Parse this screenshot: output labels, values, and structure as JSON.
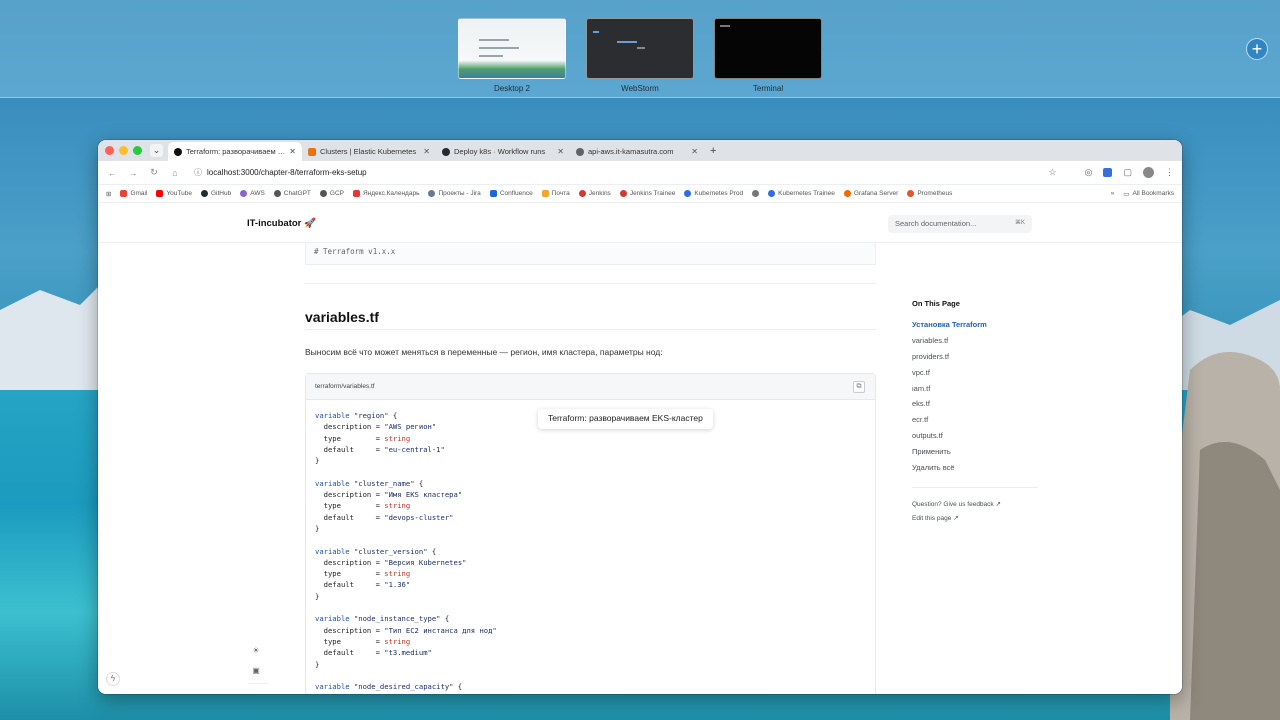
{
  "spaces": [
    {
      "label": "Desktop 2"
    },
    {
      "label": "WebStorm"
    },
    {
      "label": "Terminal"
    }
  ],
  "add_space_label": "+",
  "browser": {
    "tabs": [
      {
        "title": "Terraform: разворачиваем EKS",
        "color": "#111111",
        "active": true
      },
      {
        "title": "Clusters | Elastic Kubernetes",
        "color": "#ec7211",
        "active": false
      },
      {
        "title": "Deploy k8s · Workflow runs",
        "color": "#24292f",
        "active": false
      },
      {
        "title": "api-aws.it-kamasutra.com",
        "color": "#5f6368",
        "active": false
      }
    ],
    "url": "localhost:3000/chapter-8/terraform-eks-setup",
    "bookmarks": [
      {
        "label": "Gmail",
        "color": "#ea4335"
      },
      {
        "label": "YouTube",
        "color": "#ff0000"
      },
      {
        "label": "GitHub",
        "color": "#24292f"
      },
      {
        "label": "AWS",
        "color": "#8a63d2"
      },
      {
        "label": "ChatGPT",
        "color": "#555555"
      },
      {
        "label": "GCP",
        "color": "#555555"
      },
      {
        "label": "Яндекс.Календарь",
        "color": "#e53935"
      },
      {
        "label": "Проекты - Jira",
        "color": "#6b778c"
      },
      {
        "label": "Confluence",
        "color": "#1868db"
      },
      {
        "label": "Почта",
        "color": "#f4a62a"
      },
      {
        "label": "Jenkins",
        "color": "#d33833"
      },
      {
        "label": "Jenkins Trainee",
        "color": "#d33833"
      },
      {
        "label": "Kubernetes Prod",
        "color": "#326ce5"
      },
      {
        "label": "",
        "color": "#777777"
      },
      {
        "label": "Kubernetes Trainee",
        "color": "#326ce5"
      },
      {
        "label": "Grafana Server",
        "color": "#f46800"
      },
      {
        "label": "Prometheus",
        "color": "#e6522c"
      }
    ],
    "more_bookmarks": "»",
    "all_bookmarks": "All Bookmarks"
  },
  "site": {
    "logo": "IT-incubator 🚀",
    "search_placeholder": "Search documentation...",
    "search_shortcut": "⌘K"
  },
  "content": {
    "prev_code_comment": "# Terraform v1.x.x",
    "heading": "variables.tf",
    "paragraph": "Выносим всё что может меняться в переменные — регион, имя кластера, параметры нод:",
    "code_file": "terraform/variables.tf",
    "tooltip": "Terraform: разворачиваем EKS-кластер"
  },
  "toc": {
    "title": "On This Page",
    "items": [
      {
        "label": "Установка Terraform",
        "active": true
      },
      {
        "label": "variables.tf",
        "active": false
      },
      {
        "label": "providers.tf",
        "active": false
      },
      {
        "label": "vpc.tf",
        "active": false
      },
      {
        "label": "iam.tf",
        "active": false
      },
      {
        "label": "eks.tf",
        "active": false
      },
      {
        "label": "ecr.tf",
        "active": false
      },
      {
        "label": "outputs.tf",
        "active": false
      },
      {
        "label": "Применить",
        "active": false
      },
      {
        "label": "Удалить всё",
        "active": false
      }
    ],
    "feedback": "Question? Give us feedback ↗",
    "edit": "Edit this page ↗"
  },
  "code_lines": [
    [
      [
        "kw",
        "variable "
      ],
      [
        "str",
        "\"region\""
      ],
      [
        "",
        "{"
      ]
    ],
    [
      [
        "",
        "  description = "
      ],
      [
        "str",
        "\"AWS регион\""
      ]
    ],
    [
      [
        "",
        "  type        = "
      ],
      [
        "ty",
        "string"
      ]
    ],
    [
      [
        "",
        "  default     = "
      ],
      [
        "str",
        "\"eu-central-1\""
      ]
    ],
    [
      [
        "",
        "}"
      ]
    ],
    [
      [
        "",
        ""
      ]
    ],
    [
      [
        "kw",
        "variable "
      ],
      [
        "str",
        "\"cluster_name\""
      ],
      [
        "",
        "{"
      ]
    ],
    [
      [
        "",
        "  description = "
      ],
      [
        "str",
        "\"Имя EKS кластера\""
      ]
    ],
    [
      [
        "",
        "  type        = "
      ],
      [
        "ty",
        "string"
      ]
    ],
    [
      [
        "",
        "  default     = "
      ],
      [
        "str",
        "\"devops-cluster\""
      ]
    ],
    [
      [
        "",
        "}"
      ]
    ],
    [
      [
        "",
        ""
      ]
    ],
    [
      [
        "kw",
        "variable "
      ],
      [
        "str",
        "\"cluster_version\""
      ],
      [
        "",
        "{"
      ]
    ],
    [
      [
        "",
        "  description = "
      ],
      [
        "str",
        "\"Версия Kubernetes\""
      ]
    ],
    [
      [
        "",
        "  type        = "
      ],
      [
        "ty",
        "string"
      ]
    ],
    [
      [
        "",
        "  default     = "
      ],
      [
        "str",
        "\"1.36\""
      ]
    ],
    [
      [
        "",
        "}"
      ]
    ],
    [
      [
        "",
        ""
      ]
    ],
    [
      [
        "kw",
        "variable "
      ],
      [
        "str",
        "\"node_instance_type\""
      ],
      [
        "",
        "{"
      ]
    ],
    [
      [
        "",
        "  description = "
      ],
      [
        "str",
        "\"Тип EC2 инстанса для нод\""
      ]
    ],
    [
      [
        "",
        "  type        = "
      ],
      [
        "ty",
        "string"
      ]
    ],
    [
      [
        "",
        "  default     = "
      ],
      [
        "str",
        "\"t3.medium\""
      ]
    ],
    [
      [
        "",
        "}"
      ]
    ],
    [
      [
        "",
        ""
      ]
    ],
    [
      [
        "kw",
        "variable "
      ],
      [
        "str",
        "\"node_desired_capacity\""
      ],
      [
        "",
        "{"
      ]
    ]
  ],
  "colors": {
    "accent_link": "#1d63b8",
    "code_keyword": "#1b4fa0",
    "code_type": "#c0392b"
  },
  "icons": {
    "back": "arrow-left-icon",
    "forward": "arrow-right-icon",
    "reload": "reload-icon",
    "home": "home-icon",
    "site_info": "site-info-icon",
    "bookmark_star": "star-icon",
    "copy": "copy-icon",
    "theme": "sun-icon",
    "sidebar": "sidebar-icon",
    "bolt": "bolt-icon"
  }
}
